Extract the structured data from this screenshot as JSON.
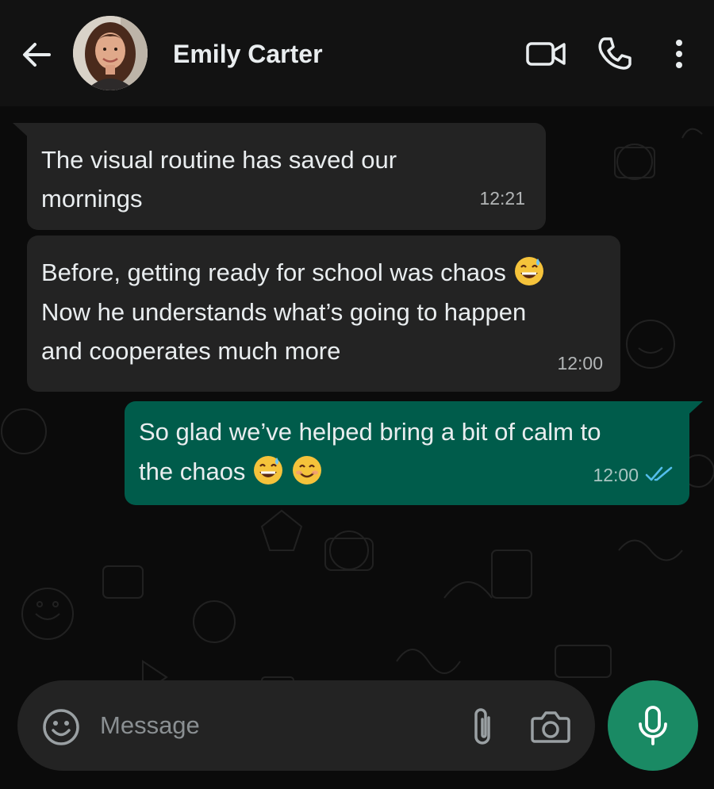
{
  "header": {
    "contact_name": "Emily Carter",
    "icons": {
      "back": "arrow-left-icon",
      "video": "video-camera-icon",
      "call": "phone-icon",
      "menu": "more-vertical-icon"
    }
  },
  "messages": [
    {
      "direction": "incoming",
      "text": "The visual routine has saved our\nmornings",
      "time": "12:21"
    },
    {
      "direction": "incoming",
      "text_line1": "Before, getting ready for school was chaos",
      "text_line1_emoji": "😅",
      "text_rest": "Now he understands what’s going to happen\nand cooperates much more",
      "time": "12:00"
    },
    {
      "direction": "outgoing",
      "text_line1": "So glad we’ve helped bring a bit of calm to",
      "text_line2": "the chaos",
      "emojis": [
        "😅",
        "😊"
      ],
      "time": "12:00",
      "status": "read-double-check-icon"
    }
  ],
  "composer": {
    "placeholder": "Message",
    "icons": {
      "emoji": "smiley-icon",
      "attach": "paperclip-icon",
      "camera": "camera-icon",
      "mic": "microphone-icon"
    }
  },
  "colors": {
    "background": "#0b0b0b",
    "header": "#121212",
    "incoming_bubble": "#232323",
    "outgoing_bubble": "#005c4b",
    "accent": "#1a8a64",
    "read_ticks": "#53bdeb"
  }
}
